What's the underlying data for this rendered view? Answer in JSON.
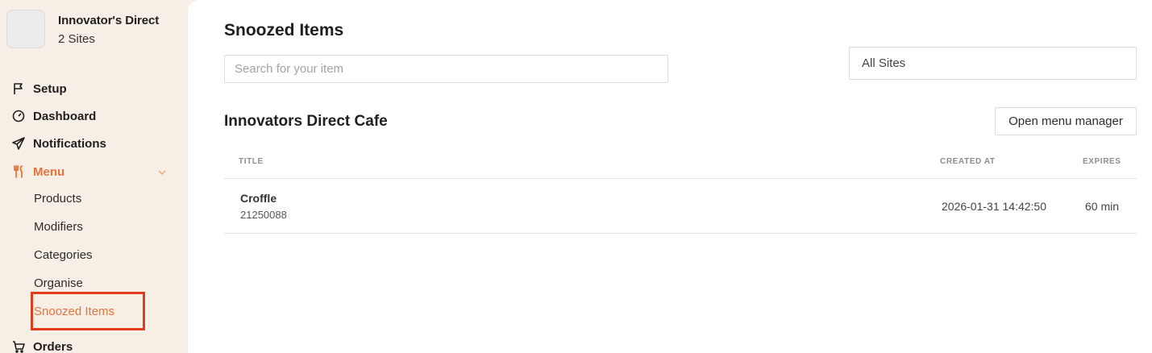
{
  "org": {
    "name": "Innovator's Direct",
    "sites": "2 Sites"
  },
  "nav": {
    "setup": "Setup",
    "dashboard": "Dashboard",
    "notifications": "Notifications",
    "menu": "Menu",
    "orders": "Orders"
  },
  "menu_sub": {
    "products": "Products",
    "modifiers": "Modifiers",
    "categories": "Categories",
    "organise": "Organise",
    "snoozed": "Snoozed Items"
  },
  "page": {
    "title": "Snoozed Items",
    "search_placeholder": "Search for your item",
    "site_filter": "All Sites"
  },
  "section": {
    "title": "Innovators Direct Cafe",
    "open_menu_button": "Open menu manager"
  },
  "table": {
    "headers": {
      "title": "TITLE",
      "created_at": "CREATED AT",
      "expires": "EXPIRES"
    },
    "rows": [
      {
        "title": "Croffle",
        "id": "21250088",
        "created_at": "2026-01-31 14:42:50",
        "expires": "60 min"
      }
    ]
  },
  "colors": {
    "accent": "#e8733b",
    "highlight": "#e23c1e",
    "sidebar_bg": "#f7efe6"
  },
  "icons": [
    "flag-icon",
    "dashboard-gauge-icon",
    "send-icon",
    "utensils-icon",
    "chevron-down-icon",
    "cart-icon"
  ]
}
